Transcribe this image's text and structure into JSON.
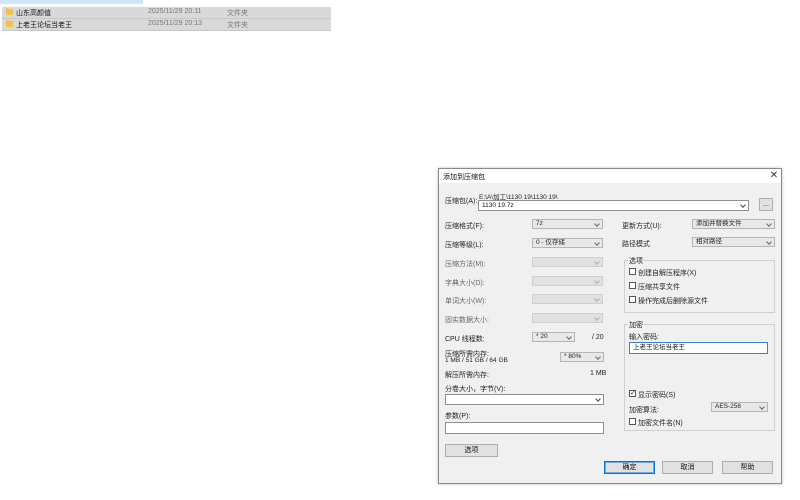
{
  "explorer": {
    "rows": [
      {
        "name": "山东高颜值",
        "date": "2025/11/29 20:11",
        "type": "文件夹"
      },
      {
        "name": "上老王论坛当老王",
        "date": "2025/11/29 20:13",
        "type": "文件夹"
      }
    ]
  },
  "dialog": {
    "title": "添加到压缩包",
    "close_glyph": "✕",
    "archive_label": "压缩包(A):",
    "archive_path": "E:\\A\\加工\\1130 19\\1130 19\\",
    "archive_name": "1130 19.7z",
    "browse_label": "...",
    "left": {
      "format_label": "压缩格式(F):",
      "format_value": "7z",
      "level_label": "压缩等级(L):",
      "level_value": "0 - 仅存储",
      "method_label": "压缩方法(M):",
      "dict_label": "字典大小(D):",
      "word_label": "单词大小(W):",
      "solid_label": "固实数据大小:",
      "threads_label": "CPU 线程数:",
      "threads_value": "* 20",
      "threads_total": "/ 20",
      "mem_comp_label": "压缩所需内存:",
      "mem_comp_value": "1 MB / 51 GB / 64 GB",
      "mem_percent": "* 80%",
      "mem_decomp_label": "解压所需内存:",
      "mem_decomp_value": "1 MB",
      "split_label": "分卷大小，字节(V):",
      "params_label": "参数(P):",
      "options_button": "选项"
    },
    "right": {
      "update_label": "更新方式(U):",
      "update_value": "添加并替换文件",
      "path_label": "路径模式",
      "path_value": "相对路径",
      "options_group": "选项",
      "opt_sfx": "创建自解压程序(X)",
      "opt_shared": "压缩共享文件",
      "opt_delete": "操作完成后删除源文件",
      "encrypt_group": "加密",
      "password_label": "输入密码:",
      "password_value": "上老王论坛当老王",
      "show_password": "显示密码(S)",
      "show_password_checked": true,
      "enc_method_label": "加密算法:",
      "enc_method_value": "AES-256",
      "encrypt_names": "加密文件名(N)"
    },
    "buttons": {
      "ok": "确定",
      "cancel": "取消",
      "help": "帮助"
    }
  }
}
